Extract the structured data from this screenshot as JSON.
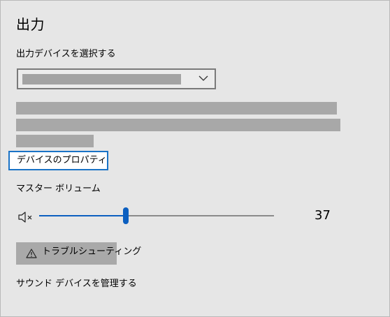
{
  "output": {
    "title": "出力",
    "select_label": "出力デバイスを選択する",
    "dropdown": {
      "selected_value": ""
    },
    "device_properties_link": "デバイスのプロパティ",
    "master_volume_label": "マスター ボリューム",
    "volume": {
      "value": "37",
      "level": 37
    },
    "troubleshoot_button": "トラブルシューティング",
    "manage_devices_link": "サウンド デバイスを管理する"
  },
  "colors": {
    "accent": "#0c5fc0",
    "focus_border": "#1a73c6",
    "redacted": "#a8a8a8"
  },
  "icons": {
    "mute": "speaker-muted-icon",
    "dropdown": "chevron-down-icon",
    "warning": "warning-triangle-icon"
  }
}
